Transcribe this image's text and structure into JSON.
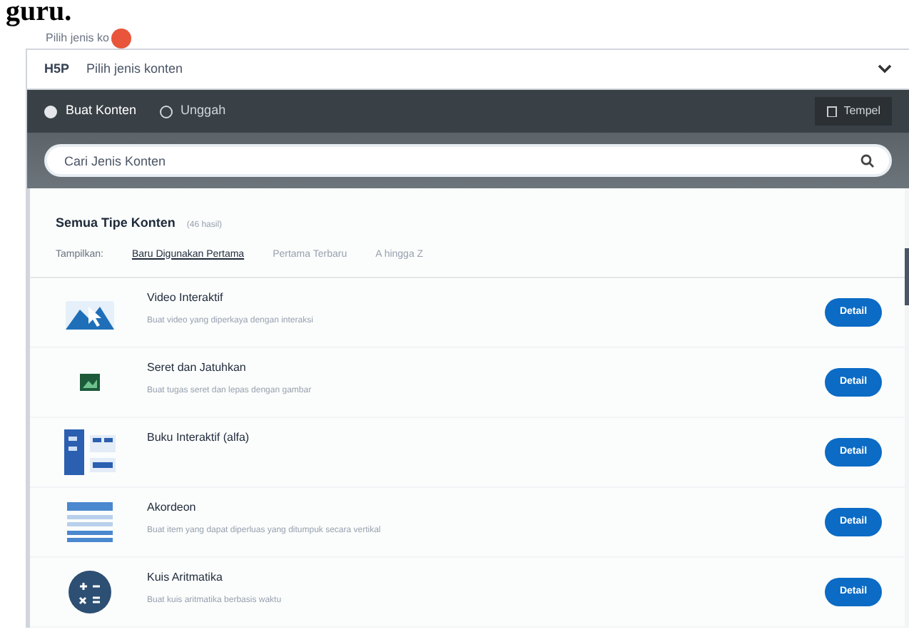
{
  "heading": "guru.",
  "field_label": "Pilih jenis ko",
  "selector": {
    "logo": "H5P",
    "placeholder": "Pilih jenis konten"
  },
  "mode_tabs": [
    {
      "label": "Buat Konten",
      "selected": true
    },
    {
      "label": "Unggah",
      "selected": false
    }
  ],
  "paste_button": "Tempel",
  "search": {
    "placeholder": "Cari Jenis Konten"
  },
  "list_title": "Semua Tipe Konten",
  "result_count": "(46 hasil)",
  "sort_label": "Tampilkan:",
  "sort_options": [
    {
      "label": "Baru Digunakan Pertama",
      "selected": true
    },
    {
      "label": "Pertama Terbaru",
      "selected": false
    },
    {
      "label": "A hingga Z",
      "selected": false
    }
  ],
  "content_types": [
    {
      "kind": "video",
      "name": "Video Interaktif",
      "description": "Buat video yang diperkaya dengan interaksi",
      "button": "Detail"
    },
    {
      "kind": "dragdrop",
      "name": "Seret dan Jatuhkan",
      "description": "Buat tugas seret dan lepas dengan gambar",
      "button": "Detail"
    },
    {
      "kind": "book",
      "name": "Buku Interaktif (alfa)",
      "button": "Detail"
    },
    {
      "kind": "accordion",
      "name": "Akordeon",
      "description": "Buat item yang dapat diperluas yang ditumpuk secara vertikal",
      "button": "Detail"
    },
    {
      "kind": "arithmetic",
      "name": "Kuis Aritmatika",
      "description": "Buat kuis aritmatika berbasis waktu",
      "button": "Detail"
    }
  ]
}
